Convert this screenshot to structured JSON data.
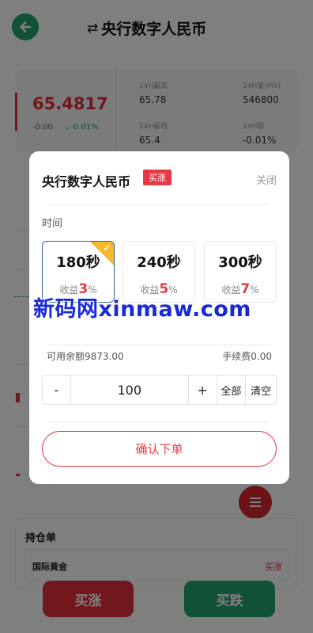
{
  "header": {
    "title": "央行数字人民币",
    "swap_icon": "⇄"
  },
  "ticker": {
    "price": "65.4817",
    "change": "-0.00",
    "change_pct": "-0.01%",
    "stats": [
      {
        "label": "24H最高",
        "value": "65.78"
      },
      {
        "label": "24H量(MX)",
        "value": "546800"
      },
      {
        "label": "24H最低",
        "value": "65.4"
      },
      {
        "label": "24H额",
        "value": "-0.01%"
      }
    ]
  },
  "modal": {
    "title": "央行数字人民币",
    "badge": "买涨",
    "close": "关闭",
    "time_label": "时间",
    "options": [
      {
        "time": "180秒",
        "rate_label": "收益",
        "rate": "3",
        "suffix": "%",
        "selected": true
      },
      {
        "time": "240秒",
        "rate_label": "收益",
        "rate": "5",
        "suffix": "%",
        "selected": false
      },
      {
        "time": "300秒",
        "rate_label": "收益",
        "rate": "7",
        "suffix": "%",
        "selected": false
      }
    ],
    "balance": "可用余额9873.00",
    "fee": "手续费0.00",
    "amount": {
      "minus": "-",
      "value": "100",
      "plus": "+",
      "all": "全部",
      "clear": "清空"
    },
    "confirm": "确认下单"
  },
  "holdings": {
    "title": "持仓单",
    "row_name": "国际黄金",
    "row_dir": "买涨"
  },
  "bottom": {
    "buy_up": "买涨",
    "buy_down": "买跌"
  },
  "watermark": "新码网xinmaw.com",
  "colors": {
    "red": "#e63946",
    "green": "#23a36b",
    "gold": "#f5b82e"
  }
}
